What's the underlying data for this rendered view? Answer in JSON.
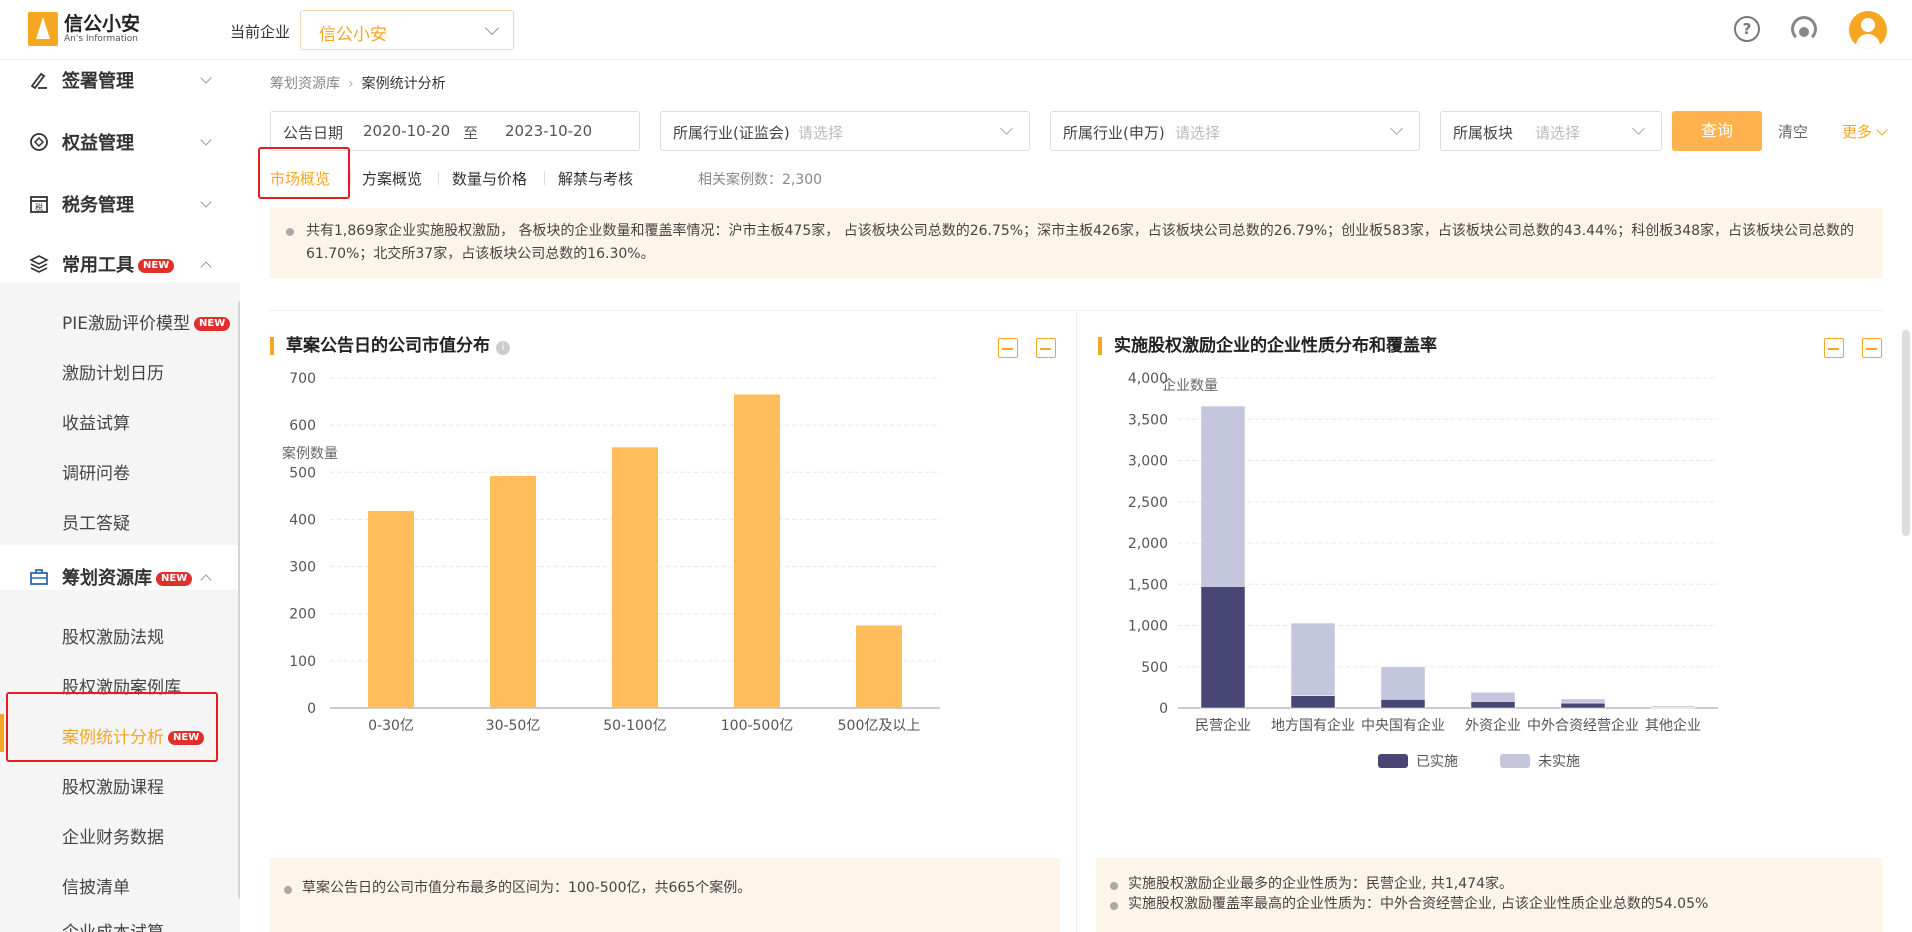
{
  "brand": {
    "name": "信公小安",
    "en": "An's Information"
  },
  "topbar": {
    "enterprise_label": "当前企业",
    "enterprise_value": "信公小安"
  },
  "sidebar": {
    "new_badge": "NEW",
    "items": [
      {
        "label": "签署管理"
      },
      {
        "label": "权益管理"
      },
      {
        "label": "税务管理"
      },
      {
        "label": "常用工具"
      },
      {
        "label": "筹划资源库"
      }
    ],
    "tools_sub": [
      "PIE激励评价模型",
      "激励计划日历",
      "收益试算",
      "调研问卷",
      "员工答疑"
    ],
    "resource_sub": [
      "股权激励法规",
      "股权激励案例库",
      "案例统计分析",
      "股权激励课程",
      "企业财务数据",
      "信披清单",
      "企业成本试算"
    ]
  },
  "breadcrumb": {
    "parent": "筹划资源库",
    "current": "案例统计分析"
  },
  "filters": {
    "date_label": "公告日期",
    "date_from": "2020-10-20",
    "date_to_sep": "至",
    "date_to": "2023-10-20",
    "industry_csrc_label": "所属行业(证监会)",
    "industry_sw_label": "所属行业(申万)",
    "board_label": "所属板块",
    "placeholder": "请选择",
    "query": "查询",
    "clear": "清空",
    "more": "更多"
  },
  "tabs": [
    "市场概览",
    "方案概览",
    "数量与价格",
    "解禁与考核"
  ],
  "case_count": "相关案例数：2,300",
  "summary": "共有1,869家企业实施股权激励， 各板块的企业数量和覆盖率情况：沪市主板475家， 占该板块公司总数的26.75%；深市主板426家，占该板块公司总数的26.79%；创业板583家，占该板块公司总数的43.44%；科创板348家，占该板块公司总数的61.70%；北交所37家，占该板块公司总数的16.30%。",
  "colors": {
    "accent": "#f5a623",
    "bar": "#ffbd5c",
    "implemented": "#474675",
    "not_implemented": "#c3c6dc"
  },
  "left_card": {
    "title": "草案公告日的公司市值分布",
    "note": "草案公告日的公司市值分布最多的区间为：100-500亿，共665个案例。"
  },
  "right_card": {
    "title": "实施股权激励企业的企业性质分布和覆盖率",
    "notes": [
      "实施股权激励企业最多的企业性质为：民营企业, 共1,474家。",
      "实施股权激励覆盖率最高的企业性质为：中外合资经营企业, 占该企业性质企业总数的54.05%"
    ]
  },
  "chart_data": [
    {
      "type": "bar",
      "title": "",
      "ylabel": "案例数量",
      "xlabel": "",
      "categories": [
        "0-30亿",
        "30-50亿",
        "50-100亿",
        "100-500亿",
        "500亿及以上"
      ],
      "values": [
        418,
        492,
        553,
        665,
        175
      ],
      "ylim": [
        0,
        700
      ],
      "yticks": [
        0,
        100,
        200,
        300,
        400,
        500,
        600,
        700
      ],
      "grid": true,
      "legend": "none"
    },
    {
      "type": "bar",
      "stacked": true,
      "title": "",
      "ylabel": "企业数量",
      "xlabel": "",
      "categories": [
        "民营企业",
        "地方国有企业",
        "中央国有企业",
        "外资企业",
        "中外合资经营企业",
        "其他企业"
      ],
      "series": [
        {
          "name": "已实施",
          "values": [
            1474,
            150,
            105,
            80,
            60,
            5
          ]
        },
        {
          "name": "未实施",
          "values": [
            2186,
            880,
            395,
            110,
            50,
            20
          ]
        }
      ],
      "ylim": [
        0,
        4000
      ],
      "yticks": [
        "0",
        "500",
        "1,000",
        "1,500",
        "2,000",
        "2,500",
        "3,000",
        "3,500",
        "4,000"
      ],
      "grid": true,
      "legend": "bottom-center"
    }
  ]
}
